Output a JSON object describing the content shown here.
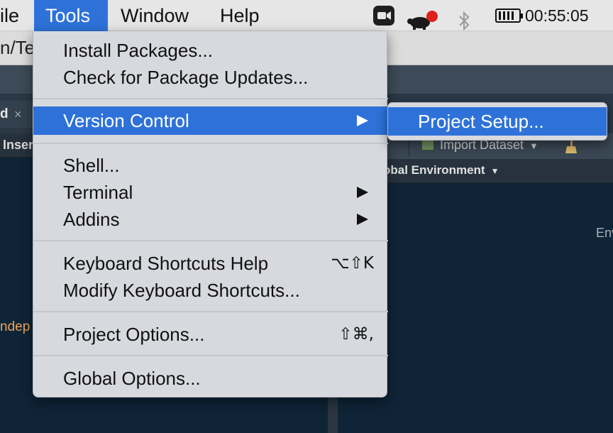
{
  "menubar": {
    "items": [
      {
        "label": "ile"
      },
      {
        "label": "Tools"
      },
      {
        "label": "Window"
      },
      {
        "label": "Help"
      }
    ],
    "status_icons": [
      "zoom-camera-icon",
      "turtle-icon",
      "bluetooth-icon",
      "battery-icon"
    ],
    "clock": "00:55:05"
  },
  "background": {
    "path_fragment": "n/Te",
    "editor_tab_label": "d",
    "editor_tab_close": "×",
    "insert_label": "Inser",
    "code_word": "ndep",
    "import_dataset": "Import Dataset",
    "global_environment": "obal Environment",
    "env_text": "Env"
  },
  "tools_menu": {
    "groups": [
      [
        {
          "label": "Install Packages...",
          "shortcut": ""
        },
        {
          "label": "Check for Package Updates...",
          "shortcut": ""
        }
      ],
      [
        {
          "label": "Version Control",
          "shortcut": "",
          "submenu": true,
          "highlighted": true
        }
      ],
      [
        {
          "label": "Shell...",
          "shortcut": ""
        },
        {
          "label": "Terminal",
          "shortcut": "",
          "submenu": true
        },
        {
          "label": "Addins",
          "shortcut": "",
          "submenu": true
        }
      ],
      [
        {
          "label": "Keyboard Shortcuts Help",
          "shortcut": "⌥⇧K"
        },
        {
          "label": "Modify Keyboard Shortcuts...",
          "shortcut": ""
        }
      ],
      [
        {
          "label": "Project Options...",
          "shortcut": "⇧⌘,"
        }
      ],
      [
        {
          "label": "Global Options...",
          "shortcut": ""
        }
      ]
    ]
  },
  "version_control_submenu": {
    "items": [
      {
        "label": "Project Setup...",
        "highlighted": true
      }
    ]
  },
  "colors": {
    "highlight": "#2e72d9",
    "menu_bg": "#d7d9de",
    "editor_bg": "#0f2437",
    "zoom_blue": "#2d8cff",
    "record_red": "#e0201b"
  }
}
